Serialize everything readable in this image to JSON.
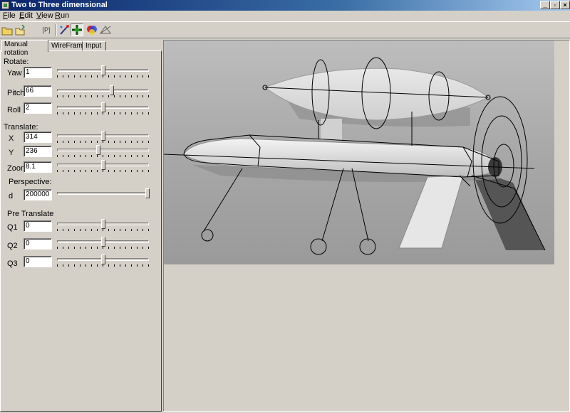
{
  "window": {
    "title": "Two to Three dimensional"
  },
  "menu": [
    {
      "label": "File",
      "mnemonic": "F",
      "rest": "ile"
    },
    {
      "label": "Edit",
      "mnemonic": "E",
      "rest": "dit"
    },
    {
      "label": "View",
      "mnemonic": "V",
      "rest": "iew"
    },
    {
      "label": "Run",
      "mnemonic": "R",
      "rest": "un"
    }
  ],
  "toolbar": {
    "buttons": [
      "open-folder",
      "load",
      "blank",
      "p-frame",
      "wand",
      "rotate-cross",
      "color-wheel",
      "wireframe-toggle"
    ],
    "p_label": "[P]",
    "colors": {
      "folder": "#f0d060",
      "accent": "#1060c0"
    }
  },
  "tabs": [
    "Manual rotation",
    "WireFrame",
    "Input"
  ],
  "rotate": {
    "heading": "Rotate:",
    "yaw": {
      "label": "Yaw",
      "value": "1",
      "slider": 0.5
    },
    "pitch": {
      "label": "Pitch",
      "value": "66",
      "slider": 0.6
    },
    "roll": {
      "label": "Roll",
      "value": "2",
      "slider": 0.5
    }
  },
  "translate": {
    "heading": "Translate:",
    "x": {
      "label": "X",
      "value": "314",
      "slider": 0.5
    },
    "y": {
      "label": "Y",
      "value": "236",
      "slider": 0.45
    },
    "zoom": {
      "label": "Zoom",
      "value": "8.1",
      "slider": 0.5
    }
  },
  "perspective": {
    "heading": "Perspective:",
    "d": {
      "label": "d",
      "value": "200000",
      "slider": 1.0
    }
  },
  "pre_translate": {
    "heading": "Pre Translate",
    "q1": {
      "label": "Q1",
      "value": "0",
      "slider": 0.5
    },
    "q2": {
      "label": "Q2",
      "value": "0",
      "slider": 0.5
    },
    "q3": {
      "label": "Q3",
      "value": "0",
      "slider": 0.5
    }
  }
}
